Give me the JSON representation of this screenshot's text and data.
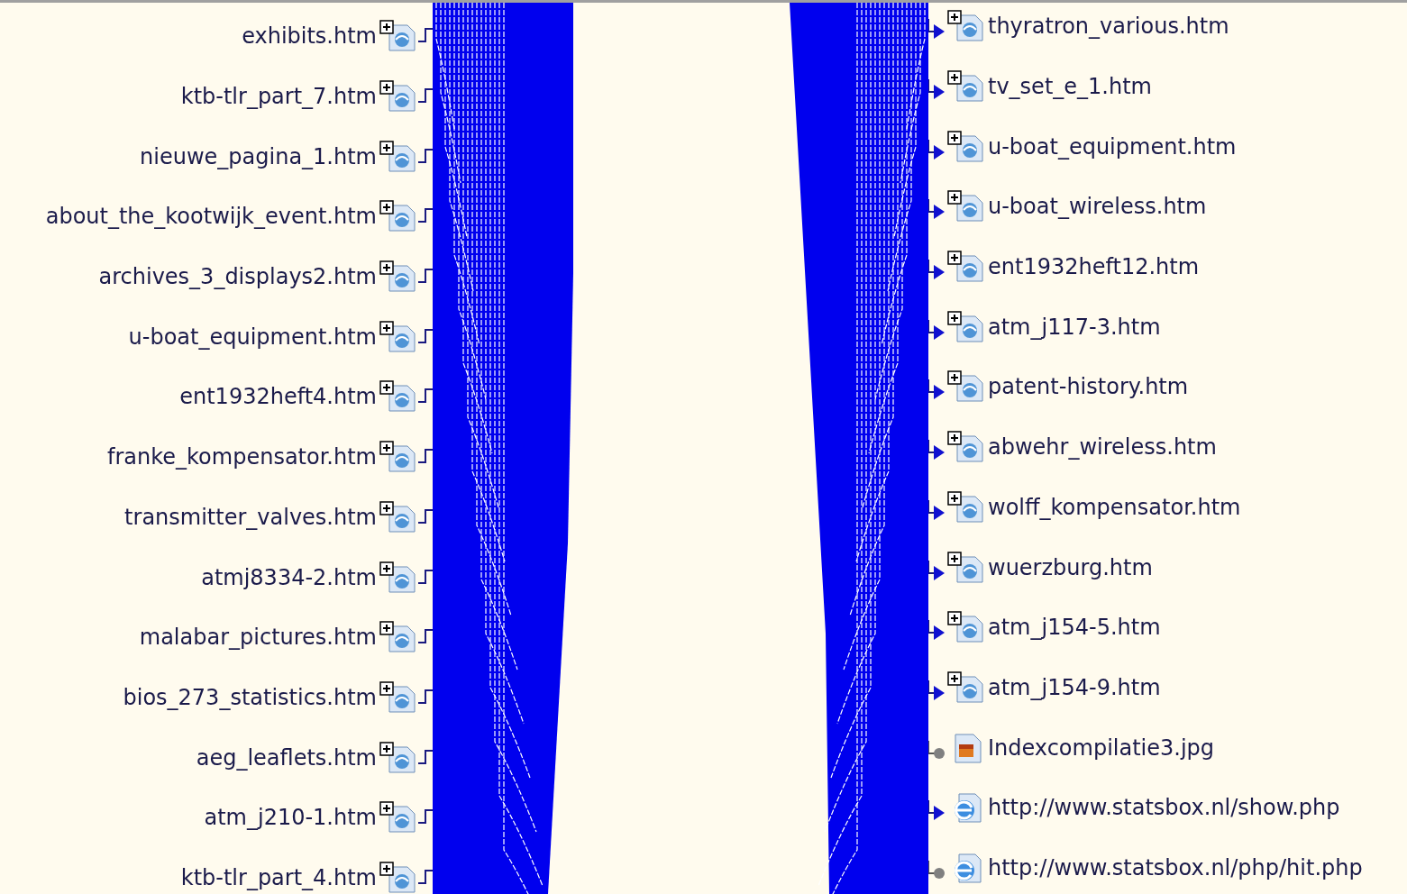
{
  "left_pages": [
    {
      "name": "exhibits.htm",
      "kind": "page"
    },
    {
      "name": "ktb-tlr_part_7.htm",
      "kind": "page"
    },
    {
      "name": "nieuwe_pagina_1.htm",
      "kind": "page"
    },
    {
      "name": "about_the_kootwijk_event.htm",
      "kind": "page"
    },
    {
      "name": "archives_3_displays2.htm",
      "kind": "page"
    },
    {
      "name": "u-boat_equipment.htm",
      "kind": "page"
    },
    {
      "name": "ent1932heft4.htm",
      "kind": "page"
    },
    {
      "name": "franke_kompensator.htm",
      "kind": "page"
    },
    {
      "name": "transmitter_valves.htm",
      "kind": "page"
    },
    {
      "name": "atmj8334-2.htm",
      "kind": "page"
    },
    {
      "name": "malabar_pictures.htm",
      "kind": "page"
    },
    {
      "name": "bios_273_statistics.htm",
      "kind": "page"
    },
    {
      "name": "aeg_leaflets.htm",
      "kind": "page"
    },
    {
      "name": "atm_j210-1.htm",
      "kind": "page"
    },
    {
      "name": "ktb-tlr_part_4.htm",
      "kind": "page"
    }
  ],
  "right_links": [
    {
      "name": "thyratron_various.htm",
      "kind": "page",
      "arrow": true
    },
    {
      "name": "tv_set_e_1.htm",
      "kind": "page",
      "arrow": true
    },
    {
      "name": "u-boat_equipment.htm",
      "kind": "page",
      "arrow": true
    },
    {
      "name": "u-boat_wireless.htm",
      "kind": "page",
      "arrow": true
    },
    {
      "name": "ent1932heft12.htm",
      "kind": "page",
      "arrow": true
    },
    {
      "name": "atm_j117-3.htm",
      "kind": "page",
      "arrow": true
    },
    {
      "name": "patent-history.htm",
      "kind": "page",
      "arrow": true
    },
    {
      "name": "abwehr_wireless.htm",
      "kind": "page",
      "arrow": true
    },
    {
      "name": "wolff_kompensator.htm",
      "kind": "page",
      "arrow": true
    },
    {
      "name": "wuerzburg.htm",
      "kind": "page",
      "arrow": true
    },
    {
      "name": "atm_j154-5.htm",
      "kind": "page",
      "arrow": true
    },
    {
      "name": "atm_j154-9.htm",
      "kind": "page",
      "arrow": true
    },
    {
      "name": "Indexcompilatie3.jpg",
      "kind": "image",
      "arrow": false
    },
    {
      "name": "http://www.statsbox.nl/show.php",
      "kind": "web",
      "arrow": true
    },
    {
      "name": "http://www.statsbox.nl/php/hit.php",
      "kind": "web",
      "arrow": false
    }
  ]
}
